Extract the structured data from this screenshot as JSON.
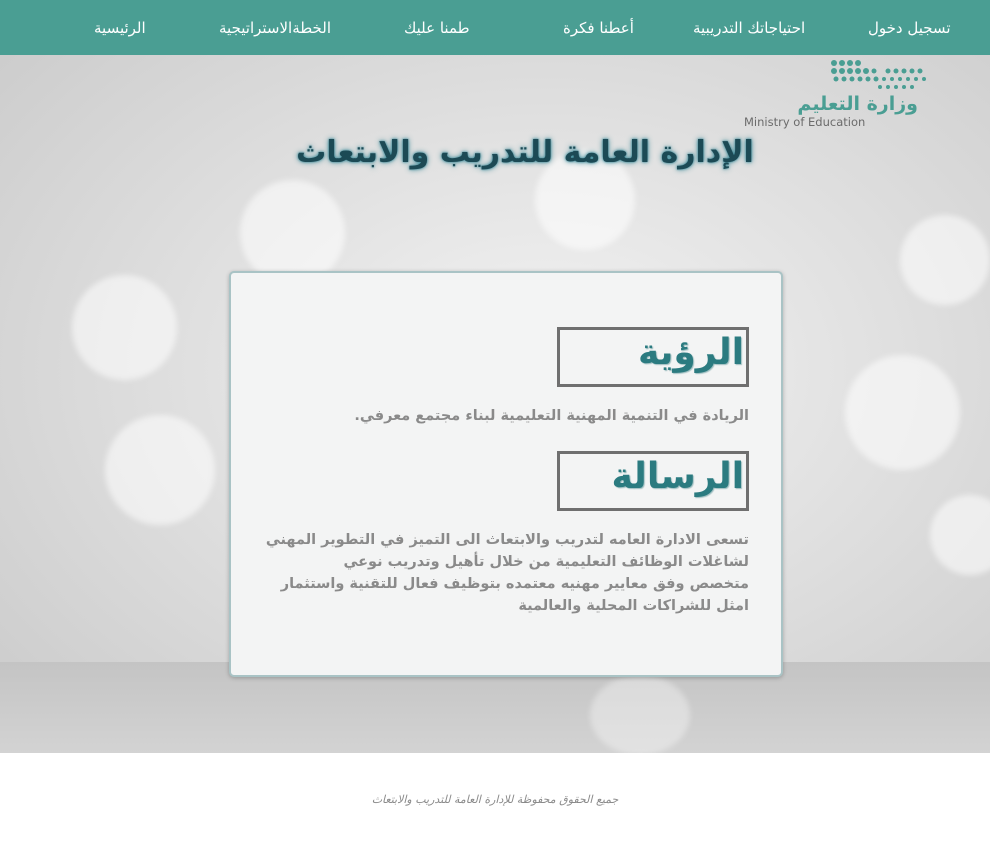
{
  "nav": {
    "login": "تسجيل دخول",
    "training_needs": "احتياجاتك التدريبية",
    "give_idea": "أعطنا فكرة",
    "reassure_us": "طمنا عليك",
    "strategic_plan": "الخطةالاستراتيجية",
    "home": "الرئيسية"
  },
  "logo": {
    "arabic": "وزارة التعليم",
    "english": "Ministry of Education"
  },
  "page_title": "الإدارة العامة للتدريب والابتعاث",
  "vision": {
    "heading": "الرؤية",
    "text": "الريادة في التنمية المهنية التعليمية لبناء مجتمع معرفي."
  },
  "mission": {
    "heading": "الرسالة",
    "lines": [
      "تسعى الادارة العامه لتدريب والابتعاث الى التميز في التطوير المهني",
      "لشاغلات الوظائف التعليمية من خلال تأهيل وتدريب نوعي",
      "متخصص وفق معايير مهنيه معتمده بتوظيف فعال للتقنية واستثمار",
      "امثل للشراكات المحلية والعالمية"
    ]
  },
  "footer": "جميع الحقوق محفوظة للإدارة العامة للتدريب والابتعاث",
  "colors": {
    "nav_bg": "#4a9e93",
    "title": "#1c4a55",
    "heading": "#2b7b80",
    "body_text": "#8a8a8a"
  }
}
